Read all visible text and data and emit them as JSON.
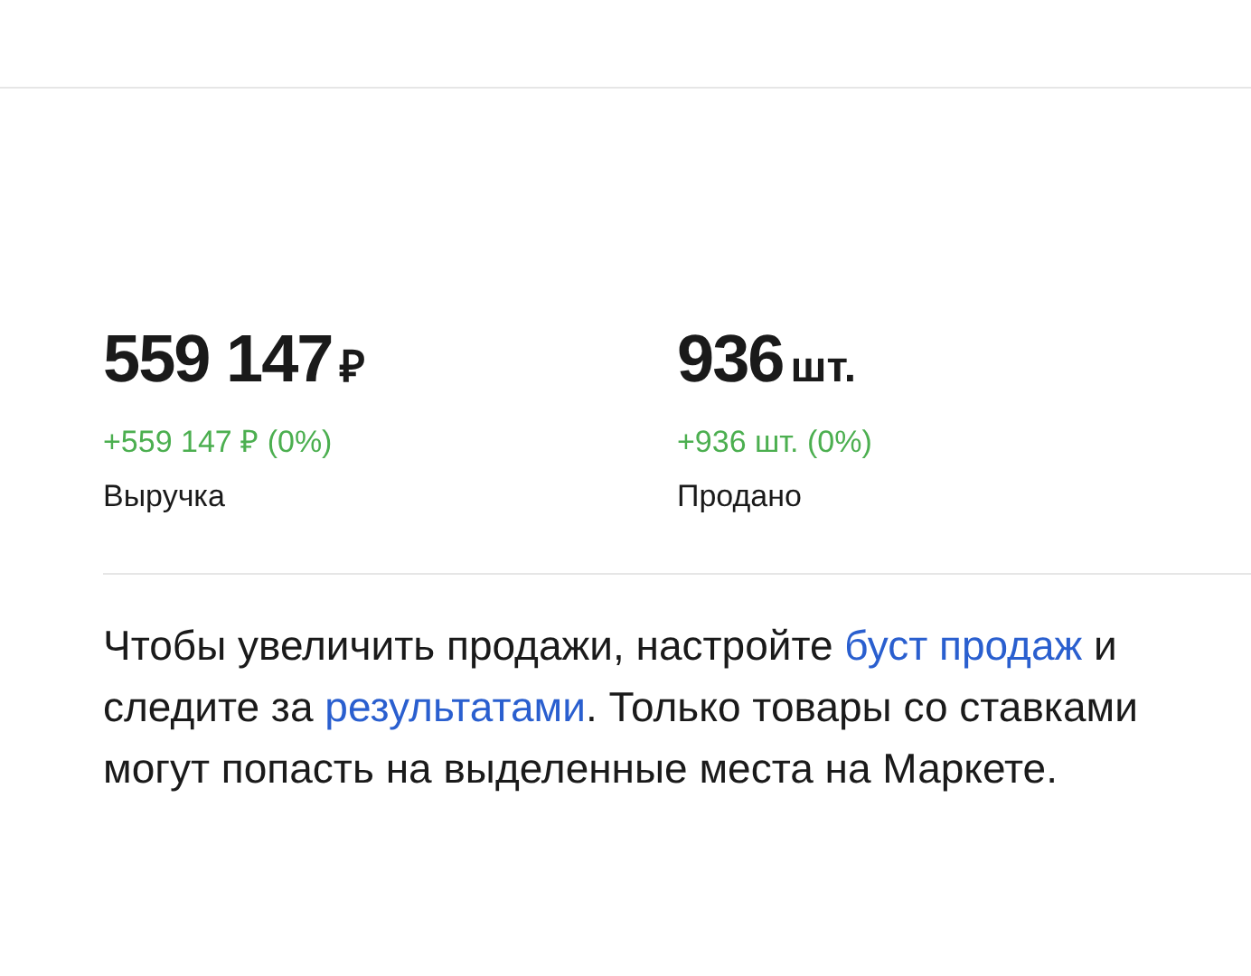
{
  "stats": [
    {
      "value": "559 147",
      "unit": "₽",
      "delta": "+559 147 ₽ (0%)",
      "label": "Выручка"
    },
    {
      "value": "936",
      "unit": "шт.",
      "delta": "+936 шт. (0%)",
      "label": "Продано"
    }
  ],
  "note": [
    {
      "kind": "text",
      "text": "Чтобы увеличить продажи, настройте "
    },
    {
      "kind": "link",
      "text": "буст продаж"
    },
    {
      "kind": "text",
      "text": " и следите за "
    },
    {
      "kind": "link",
      "text": "результатами"
    },
    {
      "kind": "text",
      "text": ". Только товары со ставками могут попасть на выделенные места на Маркете."
    }
  ]
}
